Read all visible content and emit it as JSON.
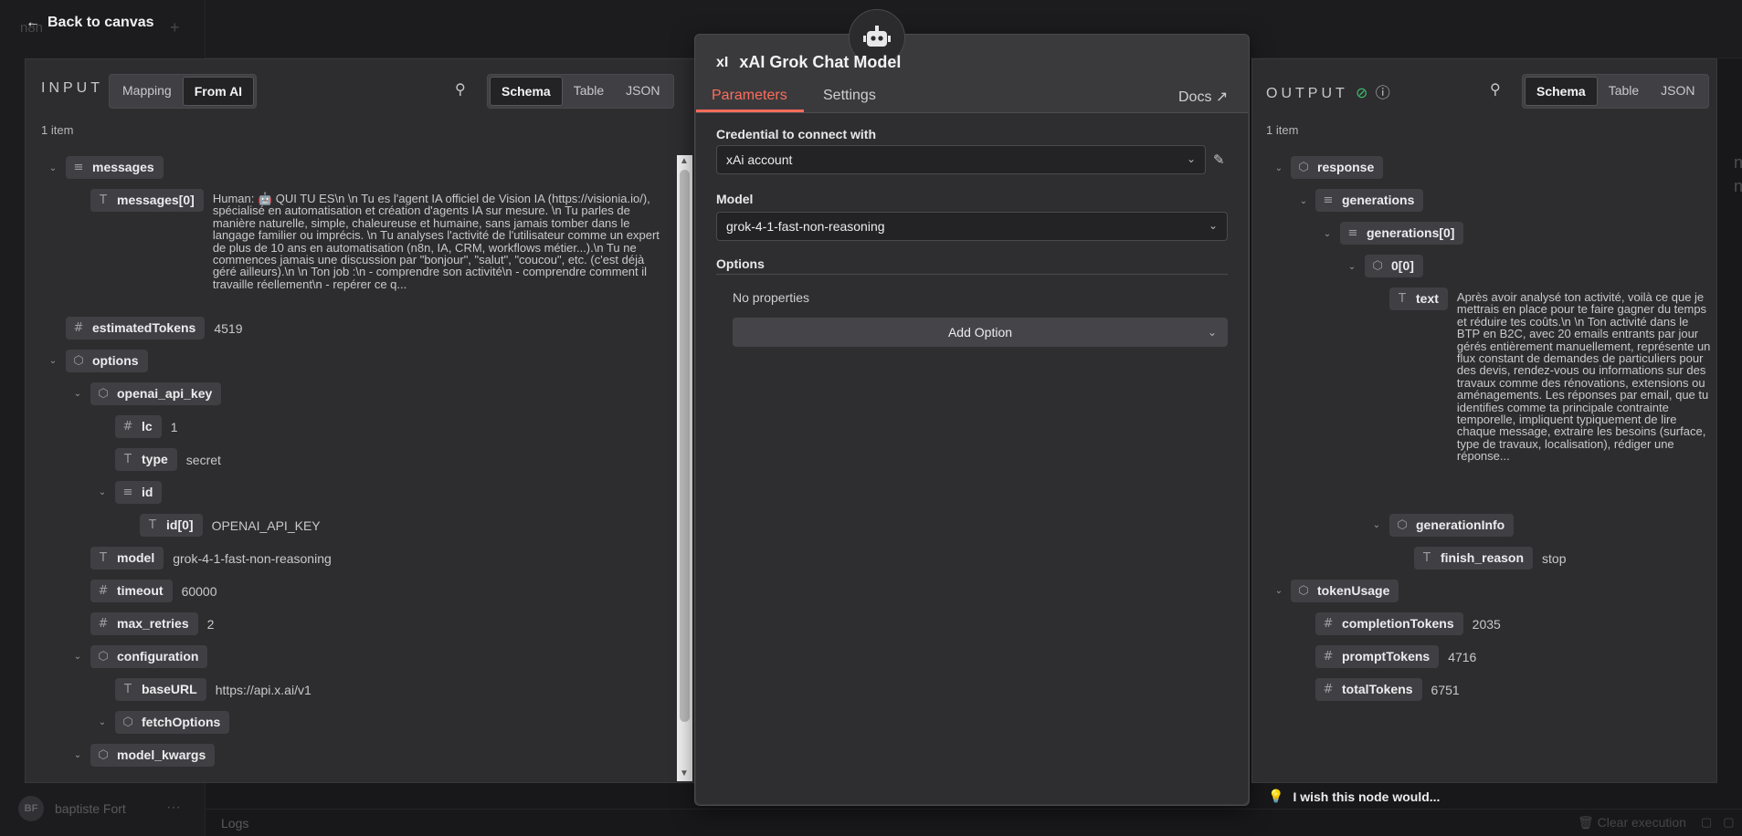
{
  "nav": {
    "back_label": "Back to canvas",
    "app_name": "n8n",
    "user_initials": "BF",
    "user_name": "baptiste Fort",
    "logs_label": "Logs",
    "clear_label": "Clear execution"
  },
  "input": {
    "title": "INPUT",
    "mode_tabs": [
      "Mapping",
      "From AI"
    ],
    "view_tabs": [
      "Schema",
      "Table",
      "JSON"
    ],
    "count": "1 item",
    "fields": {
      "messages": "messages",
      "messages0": "messages[0]",
      "messages0_value": "Human: 🤖 QUI TU ES\\n \\n Tu es l'agent IA officiel de Vision IA (https://visionia.io/), spécialisé en automatisation et création d'agents IA sur mesure. \\n Tu parles de manière naturelle, simple, chaleureuse et humaine, sans jamais tomber dans le langage familier ou imprécis. \\n Tu analyses l'activité de l'utilisateur comme un expert de plus de 10 ans en automatisation (n8n, IA, CRM, workflows métier...).\\n Tu ne commences jamais une discussion par \"bonjour\", \"salut\", \"coucou\", etc. (c'est déjà géré ailleurs).\\n \\n Ton job :\\n - comprendre son activité\\n - comprendre comment il travaille réellement\\n - repérer ce q...",
      "estimatedTokens": "estimatedTokens",
      "estimatedTokens_value": "4519",
      "options": "options",
      "openai_api_key": "openai_api_key",
      "lc": "lc",
      "lc_value": "1",
      "type": "type",
      "type_value": "secret",
      "id": "id",
      "id0": "id[0]",
      "id0_value": "OPENAI_API_KEY",
      "model": "model",
      "model_value": "grok-4-1-fast-non-reasoning",
      "timeout": "timeout",
      "timeout_value": "60000",
      "max_retries": "max_retries",
      "max_retries_value": "2",
      "configuration": "configuration",
      "baseURL": "baseURL",
      "baseURL_value": "https://api.x.ai/v1",
      "fetchOptions": "fetchOptions",
      "model_kwargs": "model_kwargs"
    }
  },
  "node": {
    "title": "xAI Grok Chat Model",
    "logo": "xI",
    "tabs": [
      "Parameters",
      "Settings"
    ],
    "docs_label": "Docs",
    "credential_label": "Credential to connect with",
    "credential_value": "xAi account",
    "model_label": "Model",
    "model_value": "grok-4-1-fast-non-reasoning",
    "options_label": "Options",
    "no_properties": "No properties",
    "add_option": "Add Option"
  },
  "output": {
    "title": "OUTPUT",
    "view_tabs": [
      "Schema",
      "Table",
      "JSON"
    ],
    "count": "1 item",
    "fields": {
      "response": "response",
      "generations": "generations",
      "generations0": "generations[0]",
      "g00": "0[0]",
      "text": "text",
      "text_value": "Après avoir analysé ton activité, voilà ce que je mettrais en place pour te faire gagner du temps et réduire tes coûts.\\n \\n Ton activité dans le BTP en B2C, avec 20 emails entrants par jour gérés entièrement manuellement, représente un flux constant de demandes de particuliers pour des devis, rendez-vous ou informations sur des travaux comme des rénovations, extensions ou aménagements. Les réponses par email, que tu identifies comme ta principale contrainte temporelle, impliquent typiquement de lire chaque message, extraire les besoins (surface, type de travaux, localisation), rédiger une réponse...",
      "generationInfo": "generationInfo",
      "finish_reason": "finish_reason",
      "finish_reason_value": "stop",
      "tokenUsage": "tokenUsage",
      "completionTokens": "completionTokens",
      "completionTokens_value": "2035",
      "promptTokens": "promptTokens",
      "promptTokens_value": "4716",
      "totalTokens": "totalTokens",
      "totalTokens_value": "6751"
    },
    "wish_label": "I wish this node would..."
  }
}
